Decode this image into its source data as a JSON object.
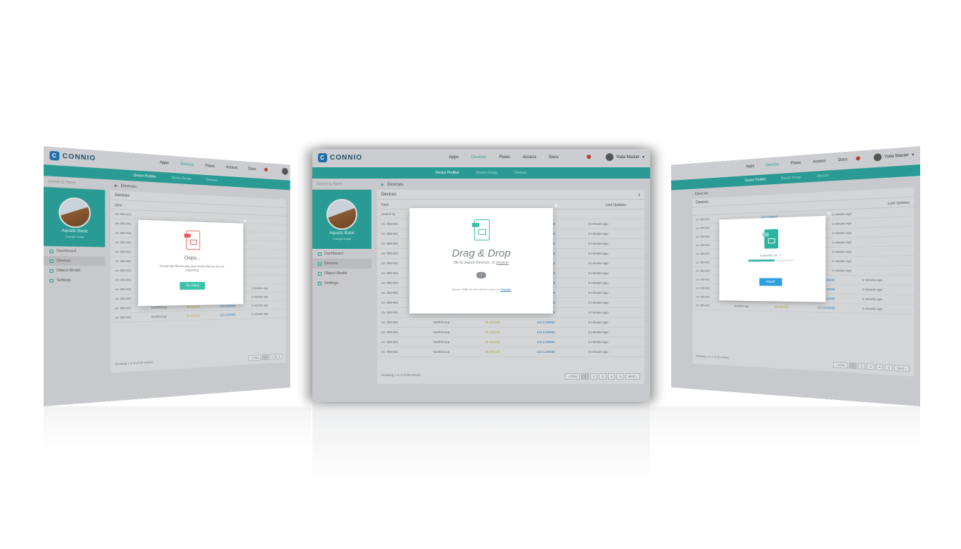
{
  "app": {
    "logo": "CONNIO",
    "logo_mark": "C"
  },
  "nav": {
    "items": [
      "Apps",
      "Devices",
      "Flows",
      "Access",
      "Docs"
    ],
    "active": "Devices",
    "user": "Yoda Master"
  },
  "subnav": {
    "items": [
      "Device Profiles",
      "Device Group",
      "Devices"
    ],
    "active": "Device Profiles"
  },
  "sidebar": {
    "search_placeholder": "Search by Name",
    "profile_name": "Aquatic Basic",
    "profile_change": "Change Image",
    "items": [
      "Dashboard",
      "Devices",
      "Object Model",
      "Settings"
    ],
    "active": "Devices"
  },
  "page": {
    "breadcrumb": "Devices",
    "panel_title": "Devices"
  },
  "table": {
    "headers": [
      "Devi",
      "",
      "",
      "",
      "Last Updates"
    ],
    "filter_placeholder": "Search by",
    "rows": [
      [
        "on: 000-001",
        "",
        "",
        "123.1139268",
        "5 minutes ago"
      ],
      [
        "on: 000-001",
        "",
        "",
        "123.1139268",
        "5 minutes ago"
      ],
      [
        "on: 000-001",
        "",
        "",
        "123.1139268",
        "5 minutes ago"
      ],
      [
        "on: 000-001",
        "",
        "",
        "123.1139268",
        "5 minutes ago"
      ],
      [
        "on: 000-001",
        "",
        "",
        "123.1139268",
        "5 minutes ago"
      ],
      [
        "on: 000-001",
        "",
        "",
        "123.1139268",
        "5 minutes ago"
      ],
      [
        "on: 000-001",
        "",
        "",
        "123.1139268",
        "5 minutes ago"
      ],
      [
        "on: 000-001",
        "",
        "",
        "123.1139268",
        "5 minutes ago"
      ],
      [
        "on: 000-001",
        "NorthGroup",
        "49.261226",
        "123.1139268",
        "5 minutes ago"
      ],
      [
        "on: 000-001",
        "NorthGroup",
        "49.261226",
        "123.1139268",
        "5 minutes ago"
      ],
      [
        "on: 000-001",
        "NorthGroup",
        "49.261226",
        "123.1139268",
        "5 minutes ago"
      ],
      [
        "on: 000-001",
        "NorthGroup",
        "49.261226",
        "123.1139268",
        "5 minutes ago"
      ],
      [
        "on: 000-001",
        "NorthGroup",
        "49.261226",
        "123.1139268",
        "5 minutes ago"
      ],
      [
        "on: 000-001",
        "NorthGroup",
        "49.261226",
        "123.1139268",
        "5 minutes ago"
      ]
    ],
    "footer": "Showing 1 to 5 of 28 entries",
    "pager": [
      "« Prev",
      "1",
      "2",
      "3",
      "4",
      "5",
      "Next »"
    ]
  },
  "modal_error": {
    "close": "×",
    "title": "Oops...",
    "text": "It looks like file test.png uses format that we are not supporting.",
    "button": "Ok, Got It",
    "color": "#e35d5d"
  },
  "modal_drop": {
    "close": "×",
    "title": "Drag & Drop",
    "subtitle": "file to import Devices, or",
    "browse": "browse",
    "hint_pre": "Upload a",
    "hint_csv": "CSV",
    "hint_mid": "file with devices using our",
    "hint_link": "Template",
    "color": "#3cc2a8"
  },
  "modal_import": {
    "close": "×",
    "filename": "importFile.csv",
    "progress": 0.58,
    "button": "Import",
    "color": "#2bb3a0",
    "button_color": "#2b9fe0"
  }
}
